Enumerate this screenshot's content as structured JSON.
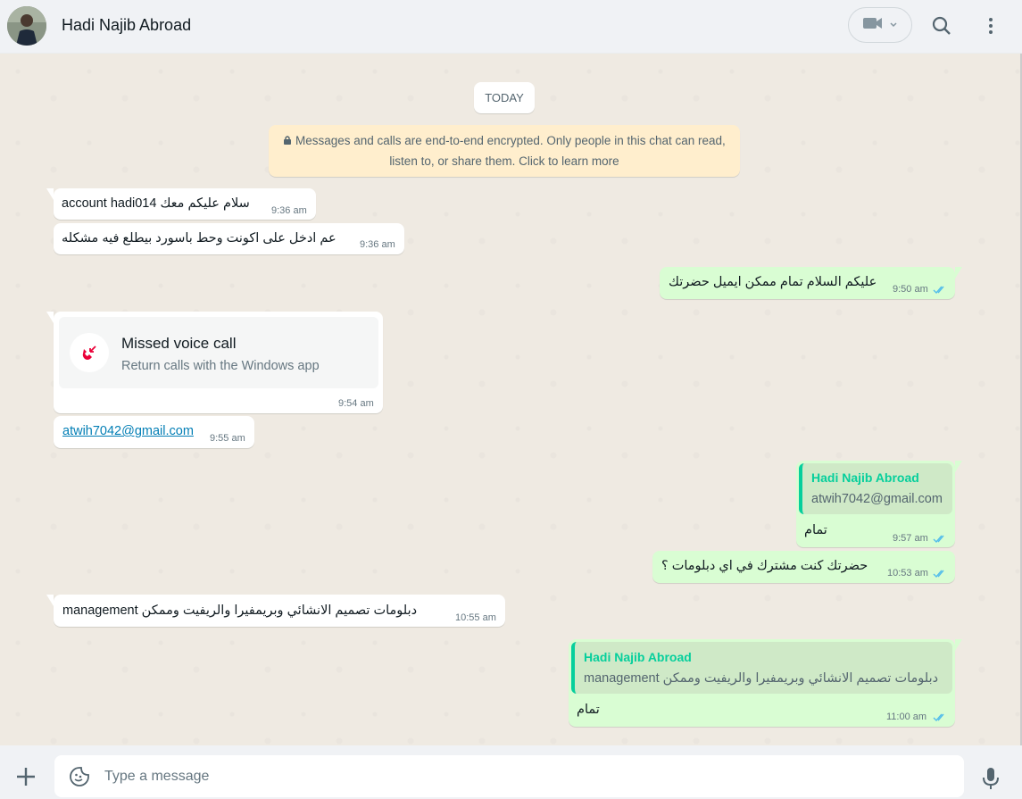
{
  "header": {
    "contact_name": "Hadi Najib Abroad"
  },
  "chat": {
    "date_chip": "TODAY",
    "encryption_notice_line1": "Messages and calls are end-to-end encrypted. Only people in this chat can read,",
    "encryption_notice_line2": "listen to, or share them. Click to learn more",
    "messages": [
      {
        "text": "سلام عليكم معك account hadi014",
        "time": "9:36 am"
      },
      {
        "text": "عم ادخل على اكونت وحط باسورد بيطلع فيه مشكله",
        "time": "9:36 am"
      },
      {
        "text": "عليكم السلام تمام ممكن ايميل حضرتك",
        "time": "9:50 am"
      },
      {
        "call_title": "Missed voice call",
        "call_subtitle": "Return calls with the Windows app",
        "time": "9:54 am"
      },
      {
        "text": "atwih7042@gmail.com",
        "time": "9:55 am"
      },
      {
        "quote_name": "Hadi Najib Abroad",
        "quote_text": "atwih7042@gmail.com",
        "text": "تمام",
        "time": "9:57 am"
      },
      {
        "text": "حضرتك كنت مشترك في اي دبلومات ؟",
        "time": "10:53 am"
      },
      {
        "text": "دبلومات تصميم  الانشائي وبريمفيرا والريفيت وممكن management",
        "time": "10:55 am"
      },
      {
        "quote_name": "Hadi Najib Abroad",
        "quote_text": "دبلومات تصميم  الانشائي وبريمفيرا والريفيت وممكن management",
        "text": "تمام",
        "time": "11:00 am"
      }
    ]
  },
  "footer": {
    "input_placeholder": "Type a message"
  },
  "colors": {
    "incoming_bubble": "#ffffff",
    "outgoing_bubble": "#d9fdd3",
    "read_ticks": "#53bdeb",
    "quote_accent": "#06cf9c",
    "missed_call": "#ea0038"
  },
  "icons": {
    "video": "video-camera-icon",
    "search": "search-icon",
    "menu": "kebab-menu-icon",
    "lock": "lock-icon",
    "missed_call": "missed-call-icon",
    "ticks": "double-check-icon",
    "plus": "plus-icon",
    "sticker": "sticker-icon",
    "mic": "microphone-icon"
  }
}
